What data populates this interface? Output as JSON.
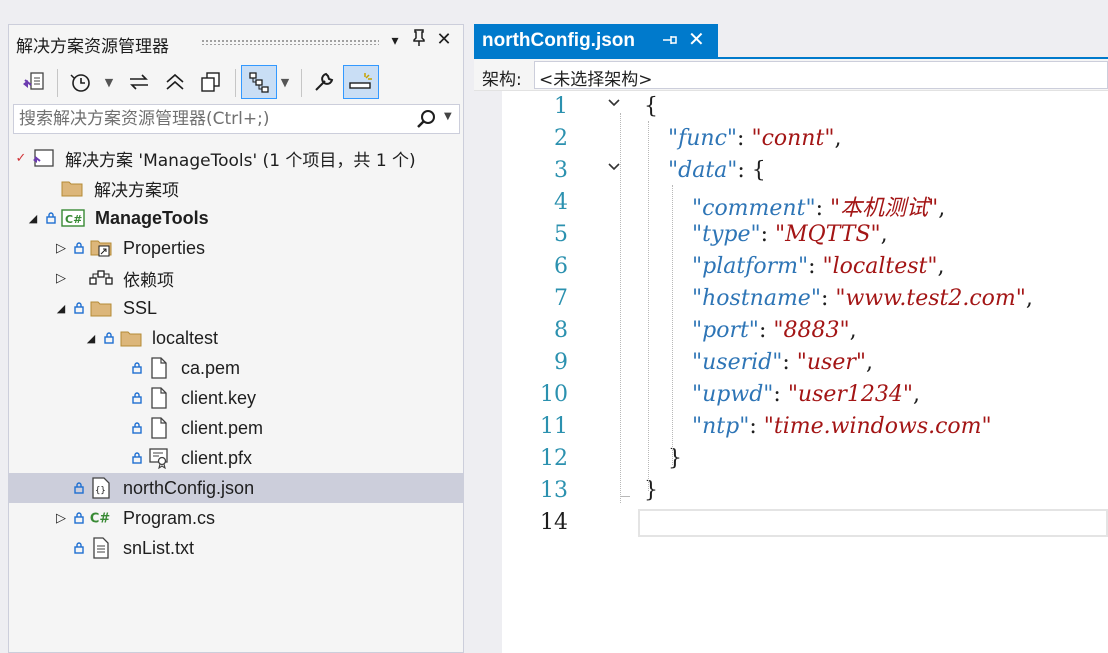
{
  "solution_explorer": {
    "title": "解决方案资源管理器",
    "search_placeholder": "搜索解决方案资源管理器(Ctrl+;)",
    "controls": {
      "dropdown": "▾",
      "pin": "⊥",
      "close": "✕"
    },
    "tree": {
      "solution": "解决方案 'ManageTools' (1 个项目，共 1 个)",
      "solution_items": "解决方案项",
      "project": "ManageTools",
      "properties": "Properties",
      "dependencies": "依赖项",
      "ssl": "SSL",
      "localtest": "localtest",
      "ca_pem": "ca.pem",
      "client_key": "client.key",
      "client_pem": "client.pem",
      "client_pfx": "client.pfx",
      "north_config": "northConfig.json",
      "program_cs": "Program.cs",
      "snlist": "snList.txt"
    }
  },
  "editor": {
    "tab_title": "northConfig.json",
    "tab_pin": "⊣",
    "tab_close": "✕",
    "schema_label": "架构:",
    "schema_value": "<未选择架构>",
    "current_line": 14,
    "lines": [
      {
        "n": "1"
      },
      {
        "n": "2",
        "key": "\"func\"",
        "value": "\"connt\"",
        "tail": ","
      },
      {
        "n": "3",
        "key": "\"data\"",
        "tail": ": {"
      },
      {
        "n": "4",
        "key": "\"comment\"",
        "value": "\"本机测试\"",
        "tail": ","
      },
      {
        "n": "5",
        "key": "\"type\"",
        "value": "\"MQTTS\"",
        "tail": ","
      },
      {
        "n": "6",
        "key": "\"platform\"",
        "value": "\"localtest\"",
        "tail": ","
      },
      {
        "n": "7",
        "key": "\"hostname\"",
        "value": "\"www.test2.com\"",
        "tail": ","
      },
      {
        "n": "8",
        "key": "\"port\"",
        "value": "\"8883\"",
        "tail": ","
      },
      {
        "n": "9",
        "key": "\"userid\"",
        "value": "\"user\"",
        "tail": ","
      },
      {
        "n": "10",
        "key": "\"upwd\"",
        "value": "\"user1234\"",
        "tail": ","
      },
      {
        "n": "11",
        "key": "\"ntp\"",
        "value": "\"time.windows.com\""
      },
      {
        "n": "12",
        "tail": "}"
      },
      {
        "n": "13",
        "tail": "}"
      },
      {
        "n": "14"
      }
    ],
    "open_brace": "{",
    "colon": ": "
  },
  "colors": {
    "accent": "#007ACC",
    "json_key": "#2E75B6",
    "json_string": "#A31515",
    "line_number": "#2B91AF",
    "csharp_green": "#388A34",
    "folder": "#DCB67A",
    "lock": "#1F6FD1"
  }
}
